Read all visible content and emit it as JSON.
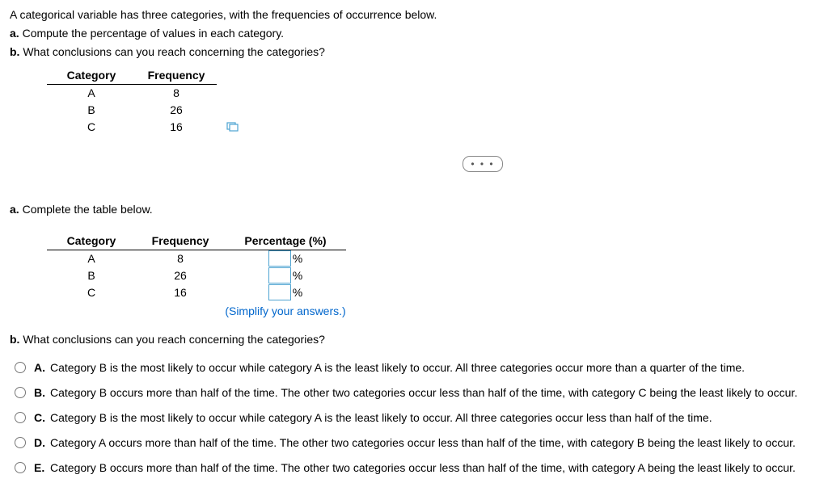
{
  "intro": {
    "line1": "A categorical variable has three categories, with the frequencies of occurrence below.",
    "line2_label": "a.",
    "line2": " Compute the percentage of values in each category.",
    "line3_label": "b.",
    "line3": " What conclusions can you reach concerning the categories?"
  },
  "table1": {
    "headers": [
      "Category",
      "Frequency"
    ],
    "rows": [
      {
        "cat": "A",
        "freq": "8"
      },
      {
        "cat": "B",
        "freq": "26"
      },
      {
        "cat": "C",
        "freq": "16"
      }
    ]
  },
  "partA": {
    "prompt_label": "a.",
    "prompt": " Complete the table below.",
    "headers": [
      "Category",
      "Frequency",
      "Percentage (%)"
    ],
    "rows": [
      {
        "cat": "A",
        "freq": "8",
        "unit": "%"
      },
      {
        "cat": "B",
        "freq": "26",
        "unit": "%"
      },
      {
        "cat": "C",
        "freq": "16",
        "unit": "%"
      }
    ],
    "simplify": "(Simplify your answers.)"
  },
  "partB": {
    "prompt_label": "b.",
    "prompt": " What conclusions can you reach concerning the categories?",
    "options": [
      {
        "label": "A.",
        "text": "Category B is the most likely to occur while category A is the least likely to occur. All three categories occur more than a quarter of the time."
      },
      {
        "label": "B.",
        "text": "Category B occurs more than half of the time. The other two categories occur less than half of the time, with category C being the least likely to occur."
      },
      {
        "label": "C.",
        "text": "Category B is the most likely to occur while category A is the least likely to occur. All three categories occur less than half of the time."
      },
      {
        "label": "D.",
        "text": "Category A occurs more than half of the time. The other two categories occur less than half of the time, with category B being the least likely to occur."
      },
      {
        "label": "E.",
        "text": "Category B occurs more than half of the time. The other two categories occur less than half of the time, with category A being the least likely to occur."
      }
    ]
  },
  "dots": "• • •"
}
